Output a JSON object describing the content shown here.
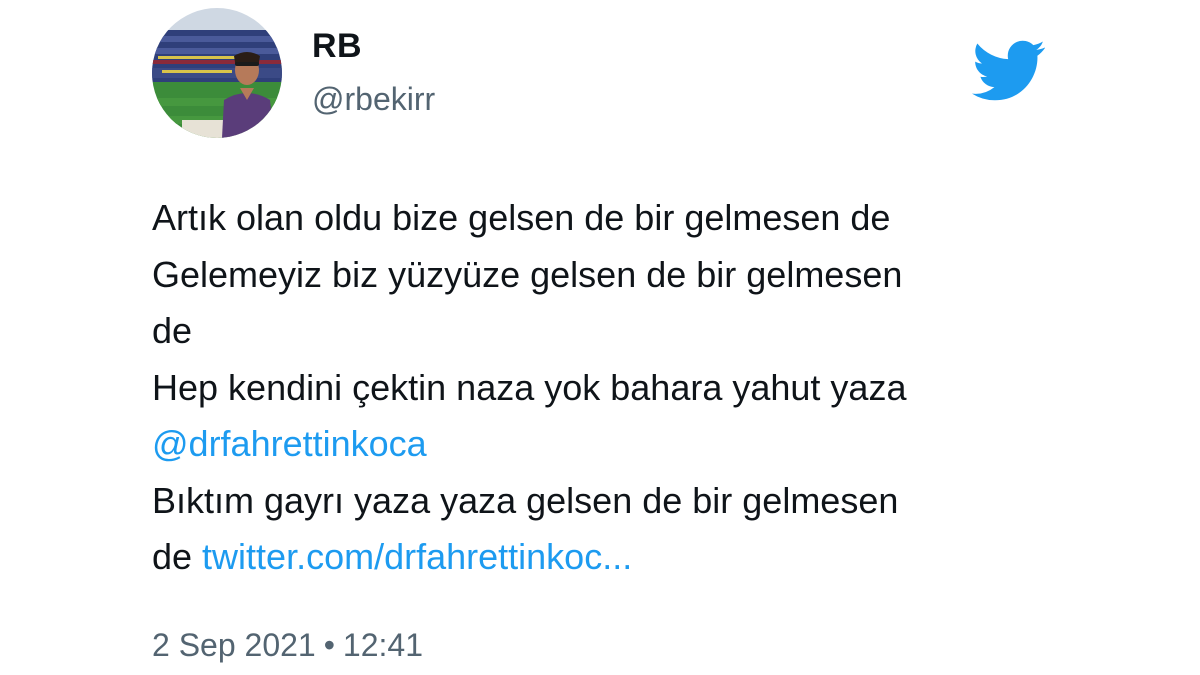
{
  "colors": {
    "link": "#1d9bf0",
    "text": "#0f1419",
    "muted": "#536471",
    "twitter_blue": "#1d9bf0"
  },
  "user": {
    "display_name": "RB",
    "handle": "@rbekirr",
    "avatar_icon": "profile-photo"
  },
  "brand_icon": "twitter-bird-icon",
  "tweet": {
    "lines": [
      "Artık olan oldu bize gelsen de bir gelmesen de",
      "Gelemeyiz biz yüzyüze gelsen de bir gelmesen",
      "de",
      "Hep kendini çektin naza yok bahara yahut yaza"
    ],
    "mention": "@drfahrettinkoca",
    "line_after_mention": "Bıktım gayrı yaza yaza gelsen de bir gelmesen",
    "last_line_prefix": "de ",
    "link_text": "twitter.com/drfahrettinkoc..."
  },
  "meta": {
    "date": "2 Sep 2021",
    "separator": "•",
    "time": "12:41"
  }
}
